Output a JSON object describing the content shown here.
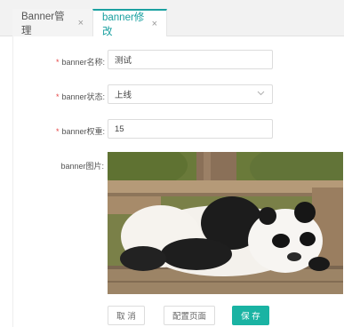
{
  "tabs": [
    {
      "label": "Banner管理",
      "close": "×"
    },
    {
      "label": "banner修改",
      "close": "×"
    }
  ],
  "form": {
    "name_label": "banner名称:",
    "name_value": "测试",
    "status_label": "banner状态:",
    "status_value": "上线",
    "weight_label": "banner权重:",
    "weight_value": "15",
    "image_label": "banner图片:",
    "required_mark": "*"
  },
  "buttons": {
    "cancel": "取 消",
    "config": "配置页面",
    "save": "保 存"
  },
  "icons": {
    "close": "close-icon",
    "dropdown": "chevron-down-icon"
  },
  "colors": {
    "accent": "#1ab3a3",
    "required": "#e54545"
  }
}
